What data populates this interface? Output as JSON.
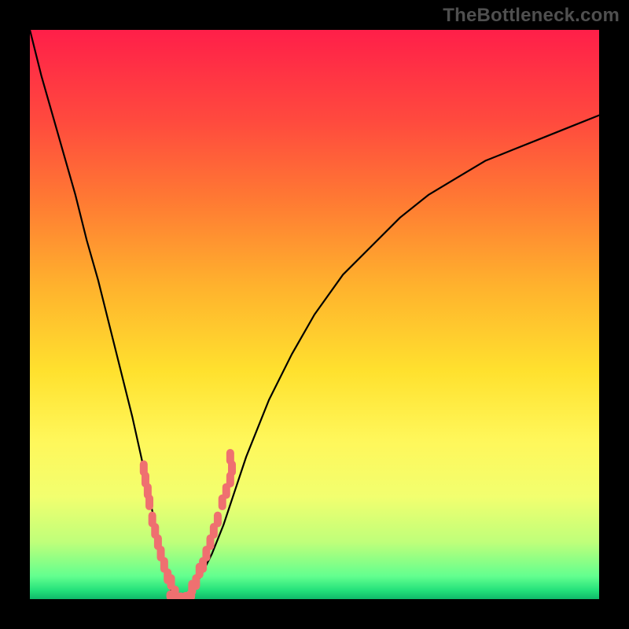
{
  "watermark": "TheBottleneck.com",
  "chart_data": {
    "type": "line",
    "title": "",
    "xlabel": "",
    "ylabel": "",
    "xlim": [
      0,
      100
    ],
    "ylim": [
      0,
      100
    ],
    "grid": false,
    "series": [
      {
        "name": "curve",
        "x": [
          0,
          2,
          4,
          6,
          8,
          10,
          12,
          14,
          16,
          18,
          20,
          21,
          22,
          23,
          24,
          25,
          26,
          27,
          28,
          30,
          32,
          34,
          36,
          38,
          40,
          42,
          46,
          50,
          55,
          60,
          65,
          70,
          75,
          80,
          85,
          90,
          95,
          100
        ],
        "values": [
          100,
          92,
          85,
          78,
          71,
          63,
          56,
          48,
          40,
          32,
          23,
          18,
          13,
          8,
          4,
          1,
          0,
          0,
          1,
          4,
          8,
          13,
          19,
          25,
          30,
          35,
          43,
          50,
          57,
          62,
          67,
          71,
          74,
          77,
          79,
          81,
          83,
          85
        ],
        "color": "#000000",
        "stroke_width": 2.2
      }
    ],
    "marker_clusters": [
      {
        "name": "left-cluster",
        "color": "#ef7070",
        "marker_width": 10,
        "marker_height_round": 20,
        "points": [
          {
            "x": 20.0,
            "y": 23
          },
          {
            "x": 20.3,
            "y": 21
          },
          {
            "x": 20.7,
            "y": 19
          },
          {
            "x": 21.0,
            "y": 17
          },
          {
            "x": 21.5,
            "y": 14
          },
          {
            "x": 22.0,
            "y": 12
          },
          {
            "x": 22.5,
            "y": 10
          },
          {
            "x": 23.0,
            "y": 8
          },
          {
            "x": 23.6,
            "y": 6
          },
          {
            "x": 24.2,
            "y": 4
          },
          {
            "x": 24.8,
            "y": 3
          },
          {
            "x": 25.5,
            "y": 1
          }
        ]
      },
      {
        "name": "bottom-cluster",
        "color": "#ef7070",
        "marker_width": 12,
        "marker_height_round": 14,
        "points": [
          {
            "x": 24.8,
            "y": 0.6
          },
          {
            "x": 25.6,
            "y": 0.3
          },
          {
            "x": 26.5,
            "y": 0.2
          },
          {
            "x": 27.4,
            "y": 0.3
          },
          {
            "x": 28.2,
            "y": 0.6
          }
        ]
      },
      {
        "name": "right-cluster",
        "color": "#ef7070",
        "marker_width": 10,
        "marker_height_round": 20,
        "points": [
          {
            "x": 28.5,
            "y": 2
          },
          {
            "x": 29.2,
            "y": 3
          },
          {
            "x": 29.8,
            "y": 5
          },
          {
            "x": 30.4,
            "y": 6
          },
          {
            "x": 31.0,
            "y": 8
          },
          {
            "x": 31.7,
            "y": 10
          },
          {
            "x": 32.3,
            "y": 12
          },
          {
            "x": 33.0,
            "y": 14
          },
          {
            "x": 33.8,
            "y": 17
          },
          {
            "x": 34.5,
            "y": 19
          },
          {
            "x": 35.2,
            "y": 21
          },
          {
            "x": 35.5,
            "y": 23
          },
          {
            "x": 35.2,
            "y": 25
          }
        ]
      }
    ]
  }
}
